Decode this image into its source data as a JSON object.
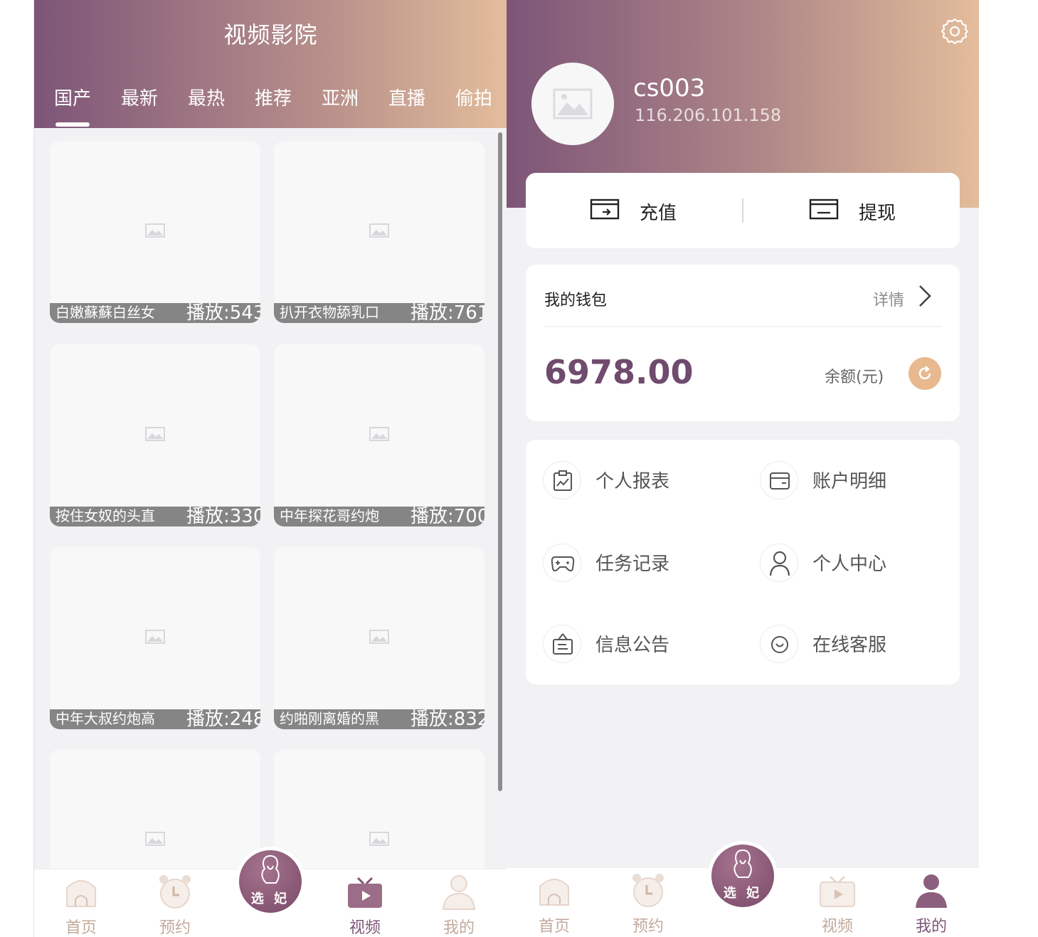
{
  "theater": {
    "title": "视频影院",
    "tabs": [
      "国产",
      "最新",
      "最热",
      "推荐",
      "亚洲",
      "直播",
      "偷拍"
    ],
    "active_tab": "国产",
    "videos": [
      {
        "caption": "白嫩蘇蘇白丝女",
        "plays": "播放:543"
      },
      {
        "caption": "扒开衣物舔乳口",
        "plays": "播放:761"
      },
      {
        "caption": "按住女奴的头直",
        "plays": "播放:330"
      },
      {
        "caption": "中年探花哥约炮",
        "plays": "播放:700"
      },
      {
        "caption": "中年大叔约炮高",
        "plays": "播放:248"
      },
      {
        "caption": "约啪刚离婚的黑",
        "plays": "播放:832"
      }
    ]
  },
  "nav": {
    "home": "首页",
    "booking": "预约",
    "center": "选 妃",
    "video": "视频",
    "mine": "我的"
  },
  "profile": {
    "username": "cs003",
    "ip": "116.206.101.158",
    "recharge": "充值",
    "withdraw": "提现",
    "wallet_title": "我的钱包",
    "wallet_detail": "详情",
    "balance": "6978.00",
    "balance_label": "余额(元)",
    "menu": [
      "个人报表",
      "账户明细",
      "任务记录",
      "个人中心",
      "信息公告",
      "在线客服"
    ]
  },
  "colors": {
    "brand_dark": "#7d5578",
    "brand_light": "#e3bd9b",
    "inactive_nav": "#c2a99b",
    "refresh": "#e8b98f"
  }
}
